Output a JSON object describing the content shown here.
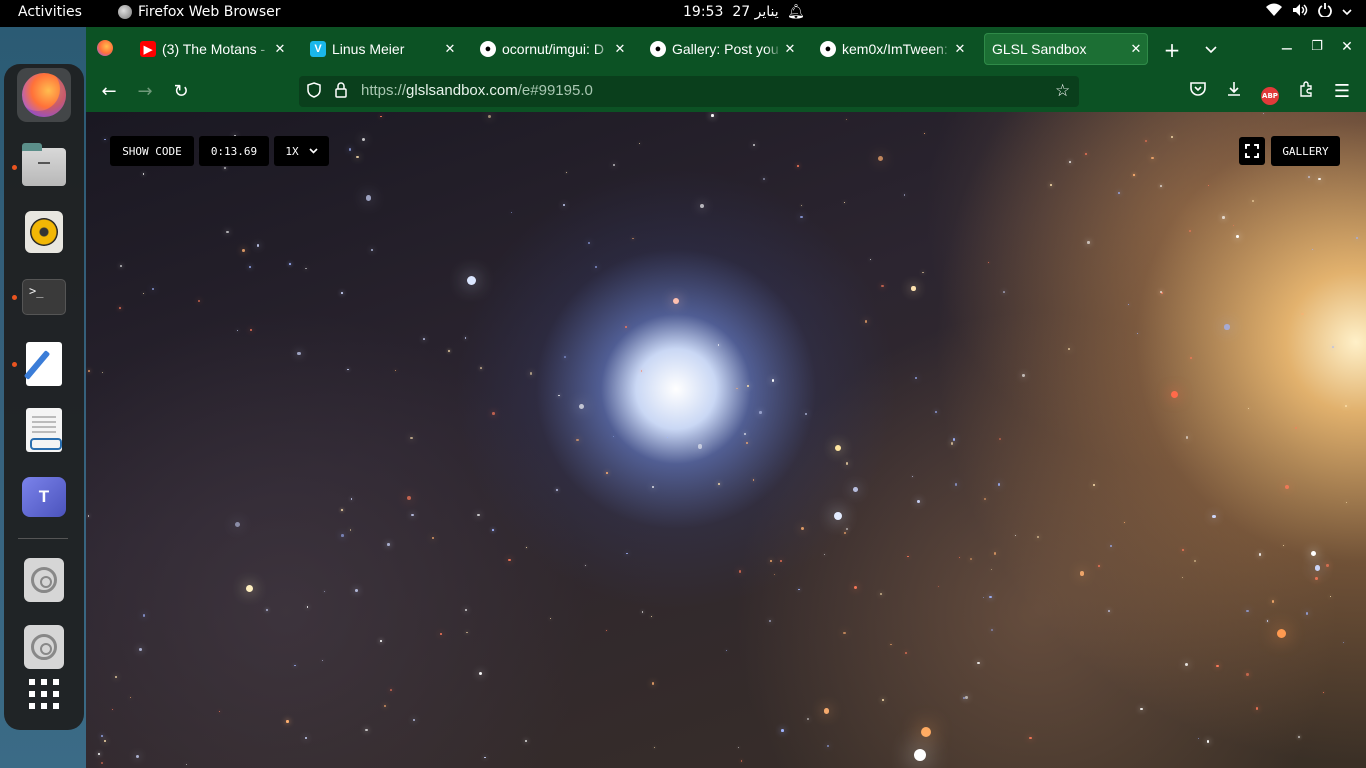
{
  "topbar": {
    "activities": "Activities",
    "app_name": "Firefox Web Browser",
    "time": "19:53",
    "date": "27 يناير"
  },
  "dock": {
    "items": [
      "firefox",
      "files",
      "rhythmbox",
      "terminal",
      "text-editor",
      "document-viewer",
      "teams",
      "disc",
      "disc",
      "show-applications"
    ]
  },
  "tabs": [
    {
      "label": "(3) The Motans - ",
      "icon": "youtube-icon"
    },
    {
      "label": "Linus Meier",
      "icon": "vimeo-icon"
    },
    {
      "label": "ocornut/imgui: D",
      "icon": "github-icon"
    },
    {
      "label": "Gallery: Post you",
      "icon": "github-icon"
    },
    {
      "label": "kem0x/ImTween:",
      "icon": "github-icon"
    },
    {
      "label": "GLSL Sandbox",
      "icon": "none"
    }
  ],
  "navbar": {
    "url_prefix": "https://",
    "url_host": "glslsandbox.com",
    "url_path": "/e#99195.0"
  },
  "sandbox": {
    "show_code": "SHOW CODE",
    "timer": "0:13.69",
    "speed": "1X",
    "gallery": "GALLERY"
  },
  "colors": {
    "toolbar": "#0c5224",
    "urlbar": "#0a3f1c",
    "accent_dot": "#e95420"
  }
}
